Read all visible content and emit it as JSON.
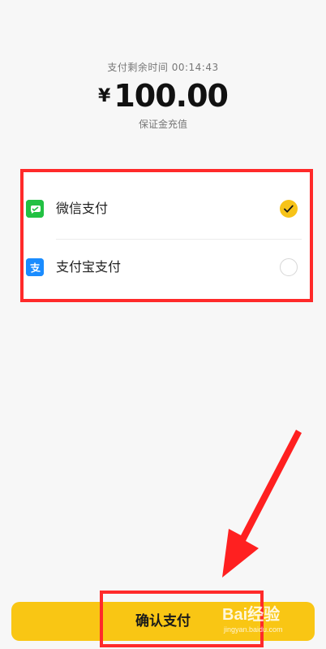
{
  "header": {
    "timer": "支付剩余时间 00:14:43",
    "currency": "¥",
    "amount": "100.00",
    "purpose": "保证金充值"
  },
  "payment_methods": [
    {
      "label": "微信支付",
      "icon": "wechat-pay-icon",
      "selected": true
    },
    {
      "label": "支付宝支付",
      "icon": "alipay-icon",
      "selected": false
    }
  ],
  "footer": {
    "confirm_label": "确认支付"
  },
  "watermark": {
    "main": "Bai经验",
    "sub": "jingyan.baidu.com"
  },
  "colors": {
    "accent": "#f9c614",
    "highlight": "#ff2a2a",
    "wechat": "#22c143",
    "alipay": "#1a8cff"
  }
}
